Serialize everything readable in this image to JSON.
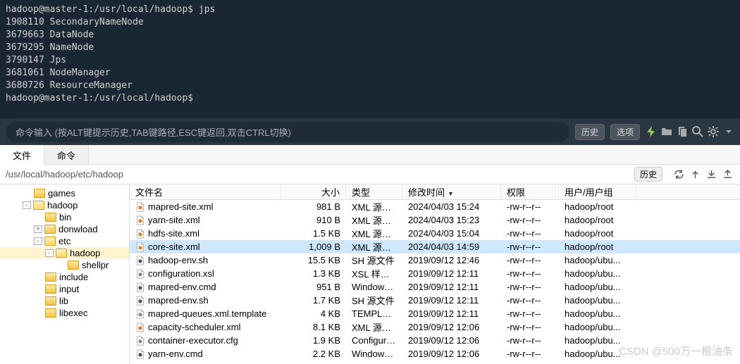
{
  "terminal": {
    "lines": [
      "hadoop@master-1:/usr/local/hadoop$ jps",
      "1908110 SecondaryNameNode",
      "3679663 DataNode",
      "3679295 NameNode",
      "3790147 Jps",
      "3681061 NodeManager",
      "3680726 ResourceManager",
      "hadoop@master-1:/usr/local/hadoop$ "
    ]
  },
  "cmdbar": {
    "placeholder": "命令输入 (按ALT键提示历史,TAB键路径,ESC键返回,双击CTRL切换)",
    "history": "历史",
    "options": "选项"
  },
  "tabs": {
    "file": "文件",
    "cmd": "命令"
  },
  "path": {
    "value": "/usr/local/hadoop/etc/hadoop",
    "history": "历史"
  },
  "tree": {
    "items": [
      {
        "indent": 2,
        "exp": null,
        "label": "games",
        "open": false
      },
      {
        "indent": 2,
        "exp": "-",
        "label": "hadoop",
        "open": true
      },
      {
        "indent": 3,
        "exp": null,
        "label": "bin",
        "open": false
      },
      {
        "indent": 3,
        "exp": "+",
        "label": "donwload",
        "open": false
      },
      {
        "indent": 3,
        "exp": "-",
        "label": "etc",
        "open": true
      },
      {
        "indent": 4,
        "exp": "-",
        "label": "hadoop",
        "open": true,
        "sel": true
      },
      {
        "indent": 5,
        "exp": null,
        "label": "shellpr",
        "open": false
      },
      {
        "indent": 3,
        "exp": null,
        "label": "include",
        "open": false
      },
      {
        "indent": 3,
        "exp": null,
        "label": "input",
        "open": false
      },
      {
        "indent": 3,
        "exp": null,
        "label": "lib",
        "open": false
      },
      {
        "indent": 3,
        "exp": null,
        "label": "libexec",
        "open": false
      }
    ]
  },
  "filecols": {
    "name": "文件名",
    "size": "大小",
    "type": "类型",
    "date": "修改时间",
    "perm": "权限",
    "owner": "用户/用户组"
  },
  "files": [
    {
      "icon": "xml",
      "name": "mapred-site.xml",
      "size": "981 B",
      "type": "XML 源文...",
      "date": "2024/04/03 15:24",
      "perm": "-rw-r--r--",
      "owner": "hadoop/root"
    },
    {
      "icon": "xml",
      "name": "yarn-site.xml",
      "size": "910 B",
      "type": "XML 源文...",
      "date": "2024/04/03 15:23",
      "perm": "-rw-r--r--",
      "owner": "hadoop/root"
    },
    {
      "icon": "xml",
      "name": "hdfs-site.xml",
      "size": "1.5 KB",
      "type": "XML 源文...",
      "date": "2024/04/03 15:04",
      "perm": "-rw-r--r--",
      "owner": "hadoop/root"
    },
    {
      "icon": "xml",
      "name": "core-site.xml",
      "size": "1,009 B",
      "type": "XML 源文...",
      "date": "2024/04/03 14:59",
      "perm": "-rw-r--r--",
      "owner": "hadoop/root",
      "sel": true
    },
    {
      "icon": "sh",
      "name": "hadoop-env.sh",
      "size": "15.5 KB",
      "type": "SH 源文件",
      "date": "2019/09/12 12:46",
      "perm": "-rw-r--r--",
      "owner": "hadoop/ubu..."
    },
    {
      "icon": "xsl",
      "name": "configuration.xsl",
      "size": "1.3 KB",
      "type": "XSL 样式表",
      "date": "2019/09/12 12:11",
      "perm": "-rw-r--r--",
      "owner": "hadoop/ubu..."
    },
    {
      "icon": "cmd",
      "name": "mapred-env.cmd",
      "size": "951 B",
      "type": "Windows ...",
      "date": "2019/09/12 12:11",
      "perm": "-rw-r--r--",
      "owner": "hadoop/ubu..."
    },
    {
      "icon": "sh",
      "name": "mapred-env.sh",
      "size": "1.7 KB",
      "type": "SH 源文件",
      "date": "2019/09/12 12:11",
      "perm": "-rw-r--r--",
      "owner": "hadoop/ubu..."
    },
    {
      "icon": "tmpl",
      "name": "mapred-queues.xml.template",
      "size": "4 KB",
      "type": "TEMPLAT...",
      "date": "2019/09/12 12:11",
      "perm": "-rw-r--r--",
      "owner": "hadoop/ubu..."
    },
    {
      "icon": "xml",
      "name": "capacity-scheduler.xml",
      "size": "8.1 KB",
      "type": "XML 源文...",
      "date": "2019/09/12 12:06",
      "perm": "-rw-r--r--",
      "owner": "hadoop/ubu..."
    },
    {
      "icon": "cfg",
      "name": "container-executor.cfg",
      "size": "1.9 KB",
      "type": "Configura...",
      "date": "2019/09/12 12:06",
      "perm": "-rw-r--r--",
      "owner": "hadoop/ubu..."
    },
    {
      "icon": "cmd",
      "name": "yarn-env.cmd",
      "size": "2.2 KB",
      "type": "Windows ...",
      "date": "2019/09/12 12:06",
      "perm": "-rw-r--r--",
      "owner": "hadoop/ubu..."
    }
  ],
  "watermark": "CSDN @500万一根油条"
}
